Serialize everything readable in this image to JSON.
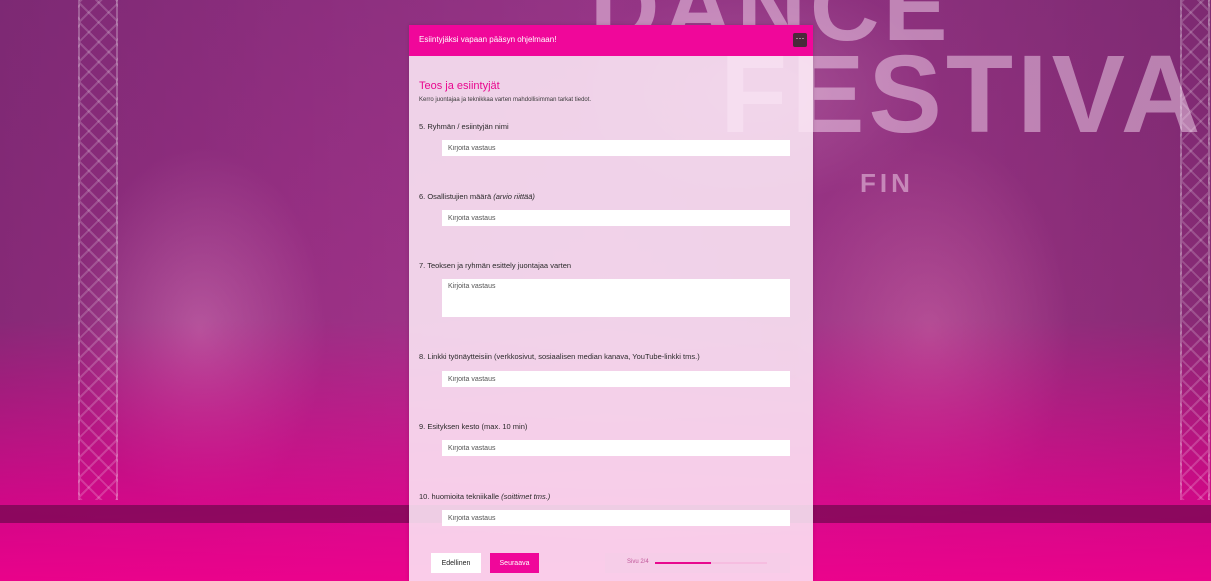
{
  "header": {
    "title": "Esiintyjäksi vapaan pääsyn ohjelmaan!",
    "menu_label": "···"
  },
  "section": {
    "title": "Teos ja esiintyjät",
    "description": "Kerro juontajaa ja teknikkaa varten mahdollisimman tarkat tiedot."
  },
  "questions": [
    {
      "label": "5. Ryhmän / esiintyjän nimi",
      "hint": "",
      "placeholder": "Kirjoita vastaus",
      "value": ""
    },
    {
      "label": "6. Osallistujien määrä",
      "hint": "(arvio riittää)",
      "placeholder": "Kirjoita vastaus",
      "value": ""
    },
    {
      "label": "7. Teoksen ja ryhmän esittely juontajaa varten",
      "hint": "",
      "placeholder": "Kirjoita vastaus",
      "value": ""
    },
    {
      "label": "8. Linkki työnäytteisiin (verkkosivut, sosiaalisen median kanava, YouTube-linkki tms.)",
      "hint": "",
      "placeholder": "Kirjoita vastaus",
      "value": ""
    },
    {
      "label": "9. Esityksen kesto (max. 10 min)",
      "hint": "",
      "placeholder": "Kirjoita vastaus",
      "value": ""
    },
    {
      "label": "10. huomioita tekniikalle",
      "hint": "(soittimet tms.)",
      "placeholder": "Kirjoita vastaus",
      "value": ""
    }
  ],
  "nav": {
    "prev_label": "Edellinen",
    "next_label": "Seuraava"
  },
  "progress": {
    "text": "Sivu 2/4",
    "current_page": 2,
    "total_pages": 4,
    "fraction": 0.5
  },
  "background": {
    "words": [
      "DANCE",
      "FESTIVAL",
      "FIN"
    ]
  },
  "colors": {
    "accent": "#f0079a",
    "accent_dark": "#e8088f",
    "panel": "#fce8f6"
  }
}
